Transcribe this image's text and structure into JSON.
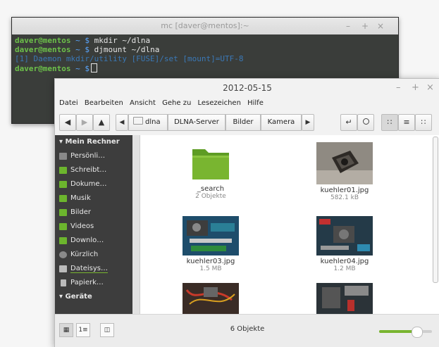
{
  "terminal": {
    "title": "mc [daver@mentos]:~",
    "controls": [
      "–",
      "+",
      "×"
    ],
    "lines": [
      {
        "user": "daver@mentos",
        "path": "~ $",
        "cmd": " mkdir ~/dlna"
      },
      {
        "user": "daver@mentos",
        "path": "~ $",
        "cmd": " djmount ~/dlna"
      },
      {
        "dim": "[1] Daemon   mkdir/utility [FUSE]/set [mount]=UTF-8"
      },
      {
        "user": "daver@mentos",
        "path": "~ $",
        "cmd": ""
      }
    ]
  },
  "file_manager": {
    "title": "2012-05-15",
    "controls": [
      "–",
      "+",
      "×"
    ],
    "menu": [
      "Datei",
      "Bearbeiten",
      "Ansicht",
      "Gehe zu",
      "Lesezeichen",
      "Hilfe"
    ],
    "breadcrumbs": [
      "dlna",
      "DLNA-Server",
      "Bilder",
      "Kamera"
    ],
    "sidebar": {
      "section_computer": "Mein Rechner",
      "items": [
        {
          "label": "Persönli…",
          "icon": "home-icon",
          "color": "#8a8a8a"
        },
        {
          "label": "Schreibt…",
          "icon": "desktop-icon",
          "color": "#6cb52d"
        },
        {
          "label": "Dokume…",
          "icon": "documents-folder-icon",
          "color": "#6cb52d"
        },
        {
          "label": "Musik",
          "icon": "music-folder-icon",
          "color": "#6cb52d"
        },
        {
          "label": "Bilder",
          "icon": "pictures-folder-icon",
          "color": "#6cb52d"
        },
        {
          "label": "Videos",
          "icon": "videos-folder-icon",
          "color": "#6cb52d"
        },
        {
          "label": "Downlo…",
          "icon": "downloads-folder-icon",
          "color": "#6cb52d"
        },
        {
          "label": "Kürzlich",
          "icon": "recent-icon",
          "color": "#8a8a8a"
        },
        {
          "label": "Dateisys…",
          "icon": "filesystem-icon",
          "color": "#bbbbbb"
        },
        {
          "label": "Papierk…",
          "icon": "trash-icon",
          "color": "#bbbbbb"
        }
      ],
      "section_devices": "Geräte"
    },
    "files": [
      {
        "name": "_search",
        "meta": "2 Objekte",
        "kind": "folder"
      },
      {
        "name": "kuehler01.jpg",
        "meta": "582.1 kB",
        "kind": "image"
      },
      {
        "name": "kuehler03.jpg",
        "meta": "1.5 MB",
        "kind": "image"
      },
      {
        "name": "kuehler04.jpg",
        "meta": "1.2 MB",
        "kind": "image"
      },
      {
        "name": "",
        "meta": "",
        "kind": "image"
      },
      {
        "name": "",
        "meta": "",
        "kind": "image"
      }
    ],
    "status_text": "6 Objekte",
    "zoom_fraction": 0.7,
    "accent_color": "#79b530"
  }
}
